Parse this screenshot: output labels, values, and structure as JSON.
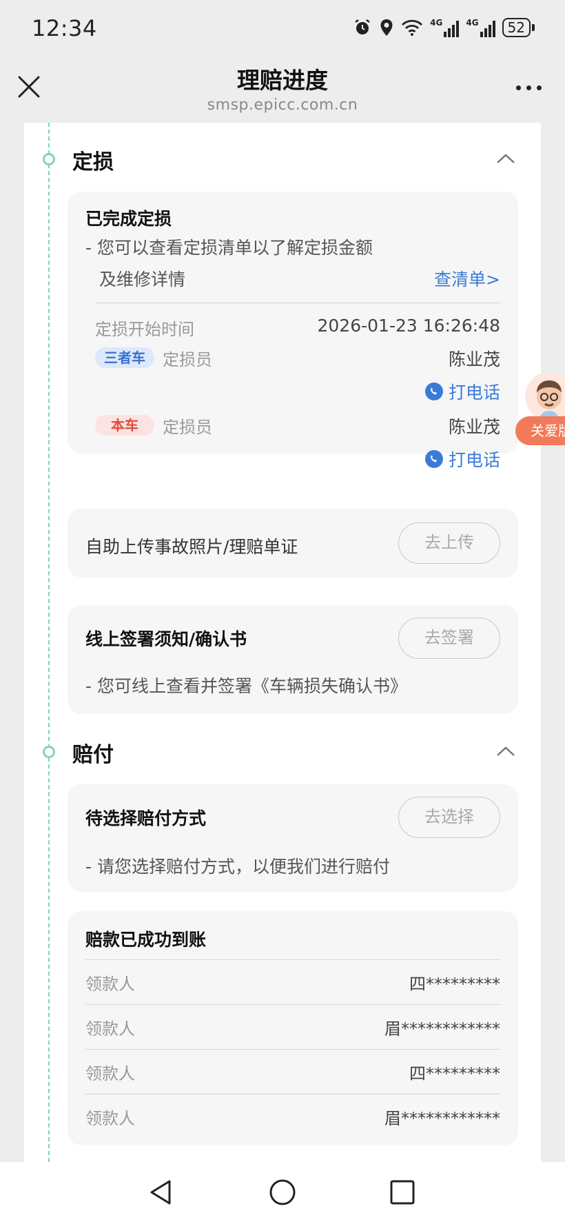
{
  "status_bar": {
    "time": "12:34",
    "net1": "4G",
    "net2": "4G",
    "battery": "52"
  },
  "header": {
    "title": "理赔进度",
    "url": "smsp.epicc.com.cn"
  },
  "sections": {
    "assessment": {
      "title": "定损"
    },
    "payment": {
      "title": "赔付"
    }
  },
  "assessment_card": {
    "title": "已完成定损",
    "desc_line1": "- 您可以查看定损清单以了解定损金额",
    "desc_line2": "及维修详情",
    "link": "查清单>",
    "start_label": "定损开始时间",
    "start_value": "2026-01-23 16:26:48",
    "third_party_tag": "三者车",
    "own_tag": "本车",
    "assessor_label": "定损员",
    "third_party_assessor": "陈业茂",
    "own_assessor": "陈业茂",
    "call_label": "打电话"
  },
  "upload_card": {
    "title": "自助上传事故照片/理赔单证",
    "button": "去上传"
  },
  "sign_card": {
    "title": "线上签署须知/确认书",
    "desc": "- 您可线上查看并签署《车辆损失确认书》",
    "button": "去签署"
  },
  "choose_card": {
    "title": "待选择赔付方式",
    "desc": "- 请您选择赔付方式，以便我们进行赔付",
    "button": "去选择"
  },
  "paid_card": {
    "title": "赔款已成功到账",
    "rows": [
      {
        "label": "领款人",
        "value": "四*********"
      },
      {
        "label": "领款人",
        "value": "眉************"
      },
      {
        "label": "领款人",
        "value": "四*********"
      },
      {
        "label": "领款人",
        "value": "眉************"
      }
    ]
  },
  "floating": {
    "label": "关爱版"
  },
  "colors": {
    "accent_link": "#3b7bd6",
    "timeline": "#7fd3bd",
    "tag_blue": "#3b6fd0",
    "tag_red": "#e04a3c",
    "float_bg": "#f07a5a"
  }
}
